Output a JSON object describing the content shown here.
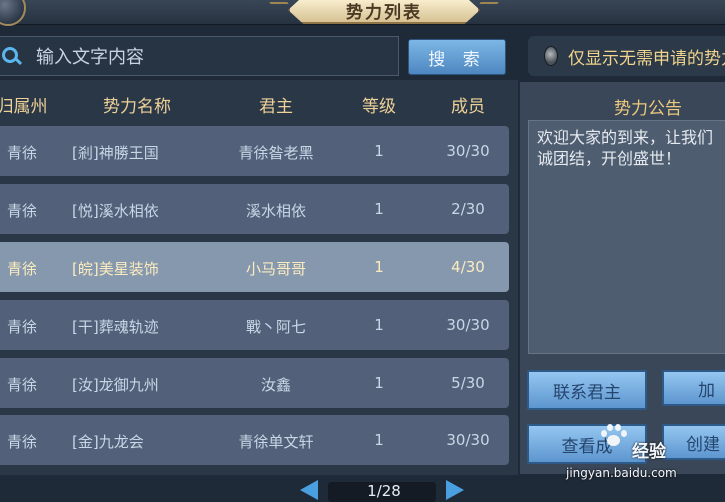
{
  "window": {
    "title": "势力列表"
  },
  "search": {
    "placeholder": "输入文字内容",
    "button_label": "搜 索"
  },
  "filter": {
    "label": "仅显示无需申请的势力",
    "checked": false
  },
  "table": {
    "headers": [
      "归属州",
      "势力名称",
      "君主",
      "等级",
      "成员"
    ],
    "rows": [
      {
        "region": "青徐",
        "name": "[剎]神勝王国",
        "leader": "青徐昝老黑",
        "level": "1",
        "members": "30/30",
        "selected": false
      },
      {
        "region": "青徐",
        "name": "[悦]溪水相依",
        "leader": "溪水相依",
        "level": "1",
        "members": "2/30",
        "selected": false
      },
      {
        "region": "青徐",
        "name": "[皖]美星装饰",
        "leader": "小马哥哥",
        "level": "1",
        "members": "4/30",
        "selected": true
      },
      {
        "region": "青徐",
        "name": "[干]葬魂轨迹",
        "leader": "戰丶阿七",
        "level": "1",
        "members": "30/30",
        "selected": false
      },
      {
        "region": "青徐",
        "name": "[汝]龙御九州",
        "leader": "汝鑫",
        "level": "1",
        "members": "5/30",
        "selected": false
      },
      {
        "region": "青徐",
        "name": "[金]九龙会",
        "leader": "青徐单文轩",
        "level": "1",
        "members": "30/30",
        "selected": false
      }
    ]
  },
  "announcement": {
    "title": "势力公告",
    "lines": [
      "欢迎大家的到来，让我们",
      "诚团结，开创盛世！"
    ]
  },
  "actions": {
    "contact_leader": "联系君主",
    "join": "加",
    "view": "查看成",
    "create": "创建"
  },
  "pagination": {
    "label": "1/28"
  },
  "watermark": {
    "brand": "经验",
    "url": "jingyan.baidu.com"
  }
}
